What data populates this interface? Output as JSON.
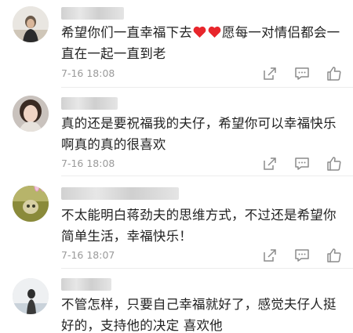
{
  "comments": [
    {
      "text_before_hearts": "希望你们一直幸福下去",
      "text_after_hearts": "愿每一对情侣都会一直在一起一直到老",
      "timestamp": "7-16 18:08"
    },
    {
      "text": "真的还是要祝福我的夫仔，希望你可以幸福快乐啊真的真的很喜欢",
      "timestamp": "7-16 18:08"
    },
    {
      "text": "不太能明白蒋劲夫的思维方式，不过还是希望你简单生活，幸福快乐！",
      "timestamp": "7-16 18:07"
    },
    {
      "text": "不管怎样，只要自己幸福就好了，感觉夫仔人挺好的，支持他的决定 喜欢他",
      "timestamp": ""
    }
  ],
  "icons": {
    "share": "share-icon",
    "reply": "comment-icon",
    "like": "thumbs-up-icon",
    "heart": "heart-icon"
  },
  "colors": {
    "heart": "#e8262c",
    "text": "#222222",
    "meta": "#9a9a9a",
    "icon": "#8c8c8c"
  }
}
